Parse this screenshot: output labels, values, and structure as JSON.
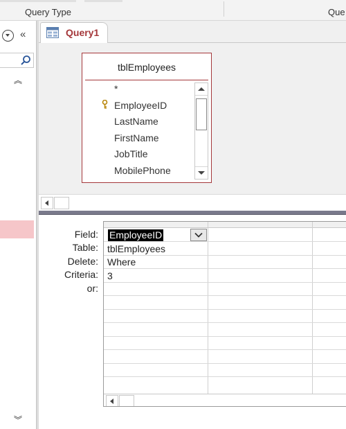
{
  "ribbon": {
    "group_label_left": "Query Type",
    "group_label_right": "Que"
  },
  "nav": {
    "menu_icon": "chevron-down-circle-icon",
    "collapse_icon": "double-chevron-left-icon",
    "collapse_glyph": "«",
    "search_icon": "search-icon",
    "scroll_up_glyph": "︽",
    "scroll_down_glyph": "︾"
  },
  "document_tab": {
    "label": "Query1",
    "icon": "query-icon"
  },
  "table_list": {
    "title": "tblEmployees",
    "fields": [
      "*",
      "EmployeeID",
      "LastName",
      "FirstName",
      "JobTitle",
      "MobilePhone"
    ],
    "primary_key_field": "EmployeeID"
  },
  "design_grid": {
    "row_labels": [
      "Field:",
      "Table:",
      "Delete:",
      "Criteria:",
      "or:"
    ],
    "columns": [
      {
        "field": "EmployeeID",
        "table": "tblEmployees",
        "delete": "Where",
        "criteria": "3"
      }
    ]
  },
  "colors": {
    "accent": "#a4373a",
    "selected_nav": "#f6c6c9",
    "splitter": "#7a7a8c"
  }
}
